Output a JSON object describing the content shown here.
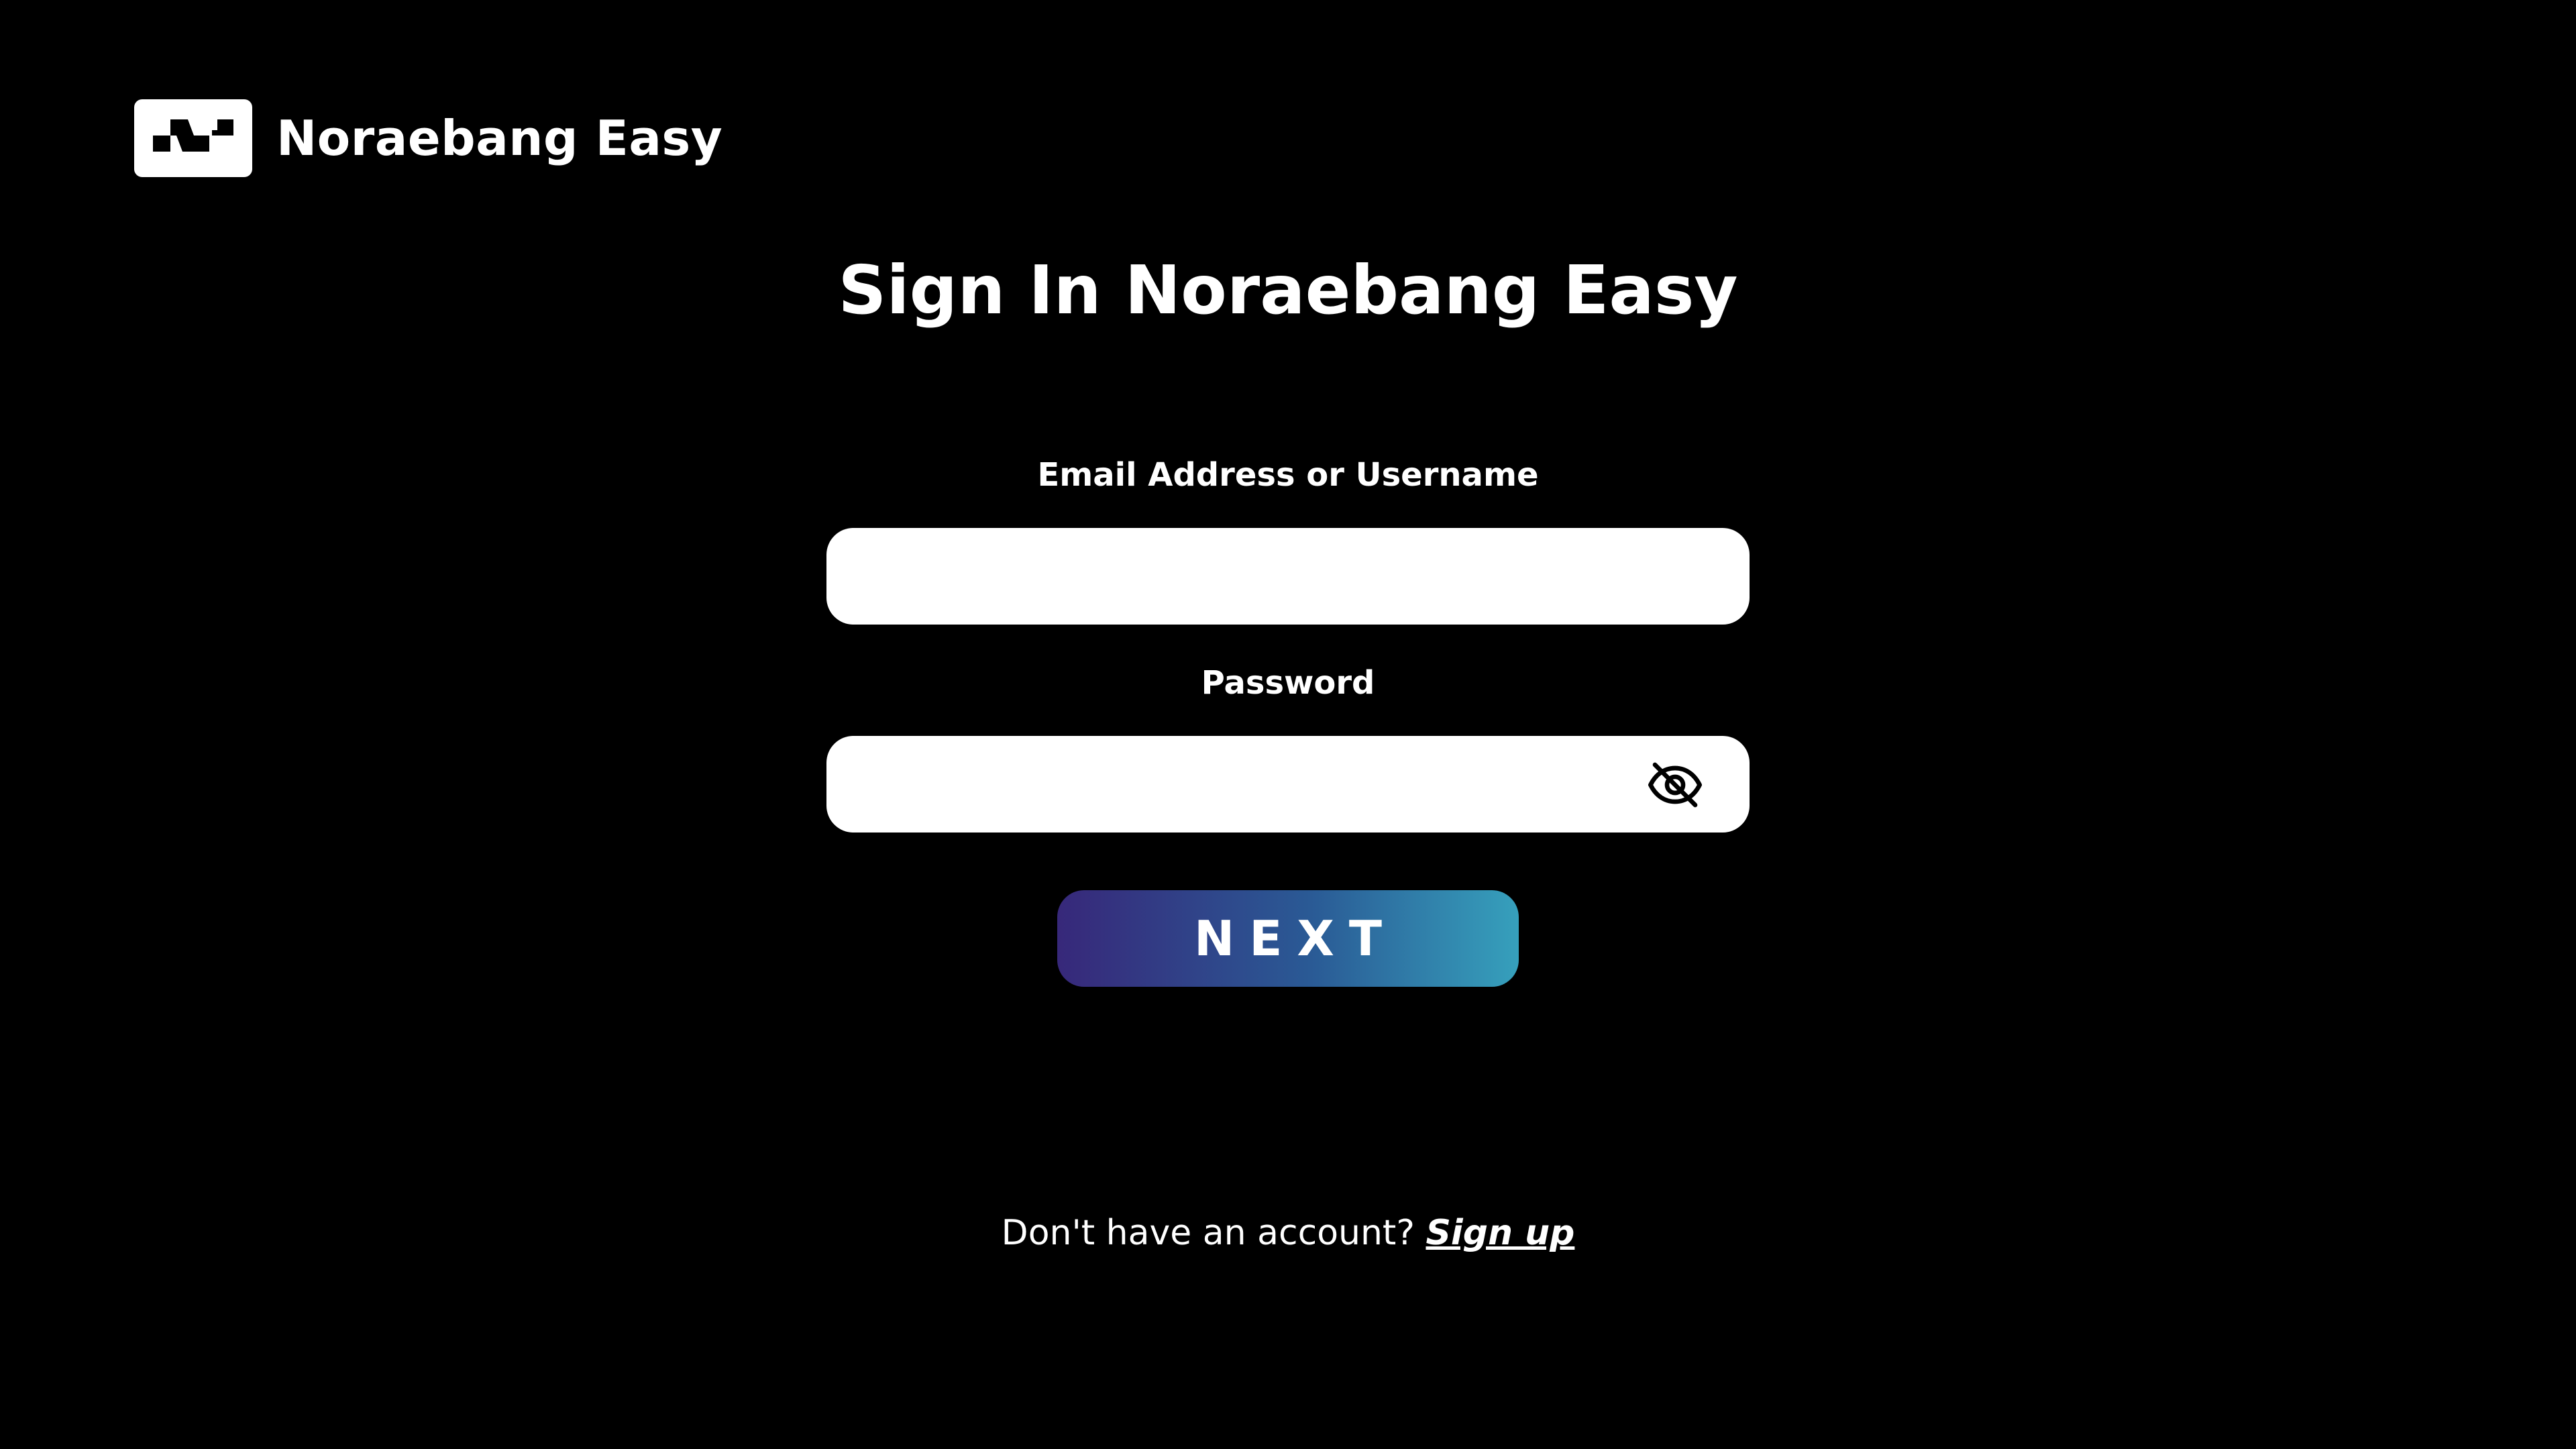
{
  "brand": {
    "logo_icon": "noraebang-logo-icon",
    "name": "Noraebang Easy"
  },
  "page_title": "Sign In Noraebang Easy",
  "form": {
    "email": {
      "label": "Email Address or Username",
      "value": "",
      "placeholder": ""
    },
    "password": {
      "label": "Password",
      "value": "",
      "placeholder": "",
      "toggle_icon": "eye-slash-icon"
    },
    "next_label": "NEXT"
  },
  "signup": {
    "prompt": "Don't have an account?",
    "link_label": "Sign up"
  },
  "colors": {
    "background": "#000000",
    "text": "#ffffff",
    "input_background": "#ffffff",
    "button_gradient_start": "#37287a",
    "button_gradient_end": "#36a0bc"
  }
}
